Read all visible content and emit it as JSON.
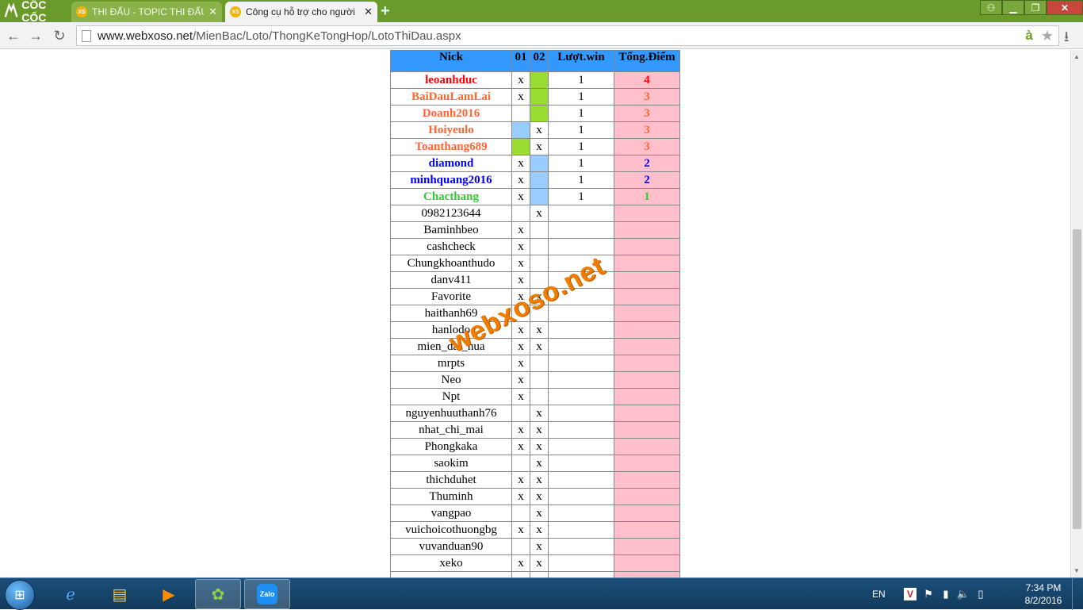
{
  "browser": {
    "brand_label": "CỐC CỐC",
    "tabs": [
      {
        "label": "THI ĐẤU - TOPIC THI ĐẤU",
        "favicon": "XS"
      },
      {
        "label": "Công cụ hỗ trợ cho người",
        "favicon": "XS"
      }
    ],
    "url_host": "www.webxoso.net",
    "url_path": "/MienBac/Loto/ThongKeTongHop/LotoThiDau.aspx"
  },
  "table": {
    "headers": {
      "nick": "Nick",
      "c01": "01",
      "c02": "02",
      "win": "Lượt.win",
      "points": "Tổng.Điểm"
    },
    "rows": [
      {
        "nick": "leoanhduc",
        "c01": "x",
        "c02": "",
        "win": "1",
        "points": "4",
        "color": "#ff0000",
        "mark02": "green"
      },
      {
        "nick": "BaiDauLamLai",
        "c01": "x",
        "c02": "",
        "win": "1",
        "points": "3",
        "color": "#ff6633",
        "mark02": "green"
      },
      {
        "nick": "Doanh2016",
        "c01": "",
        "c02": "",
        "win": "1",
        "points": "3",
        "color": "#ff6633",
        "mark02": "green"
      },
      {
        "nick": "Hoiyeulo",
        "c01": "",
        "c02": "x",
        "win": "1",
        "points": "3",
        "color": "#ff6633",
        "mark01": "blue"
      },
      {
        "nick": "Toanthang689",
        "c01": "",
        "c02": "x",
        "win": "1",
        "points": "3",
        "color": "#ff6633",
        "mark01": "green"
      },
      {
        "nick": "diamond",
        "c01": "x",
        "c02": "",
        "win": "1",
        "points": "2",
        "color": "#0000ff",
        "mark02": "blue"
      },
      {
        "nick": "minhquang2016",
        "c01": "x",
        "c02": "",
        "win": "1",
        "points": "2",
        "color": "#0000ff",
        "mark02": "blue"
      },
      {
        "nick": "Chacthang",
        "c01": "x",
        "c02": "",
        "win": "1",
        "points": "1",
        "color": "#33cc33",
        "mark02": "blue"
      },
      {
        "nick": "0982123644",
        "c01": "",
        "c02": "x",
        "win": "",
        "points": ""
      },
      {
        "nick": "Baminhbeo",
        "c01": "x",
        "c02": "",
        "win": "",
        "points": ""
      },
      {
        "nick": "cashcheck",
        "c01": "x",
        "c02": "",
        "win": "",
        "points": ""
      },
      {
        "nick": "Chungkhoanthudo",
        "c01": "x",
        "c02": "",
        "win": "",
        "points": ""
      },
      {
        "nick": "danv411",
        "c01": "x",
        "c02": "",
        "win": "",
        "points": ""
      },
      {
        "nick": "Favorite",
        "c01": "x",
        "c02": "x",
        "win": "",
        "points": ""
      },
      {
        "nick": "haithanh69",
        "c01": "",
        "c02": "",
        "win": "",
        "points": ""
      },
      {
        "nick": "hanlodo",
        "c01": "x",
        "c02": "x",
        "win": "",
        "points": ""
      },
      {
        "nick": "mien_dat_hua",
        "c01": "x",
        "c02": "x",
        "win": "",
        "points": ""
      },
      {
        "nick": "mrpts",
        "c01": "x",
        "c02": "",
        "win": "",
        "points": ""
      },
      {
        "nick": "Neo",
        "c01": "x",
        "c02": "",
        "win": "",
        "points": ""
      },
      {
        "nick": "Npt",
        "c01": "x",
        "c02": "",
        "win": "",
        "points": ""
      },
      {
        "nick": "nguyenhuuthanh76",
        "c01": "",
        "c02": "x",
        "win": "",
        "points": ""
      },
      {
        "nick": "nhat_chi_mai",
        "c01": "x",
        "c02": "x",
        "win": "",
        "points": ""
      },
      {
        "nick": "Phongkaka",
        "c01": "x",
        "c02": "x",
        "win": "",
        "points": ""
      },
      {
        "nick": "saokim",
        "c01": "",
        "c02": "x",
        "win": "",
        "points": ""
      },
      {
        "nick": "thichduhet",
        "c01": "x",
        "c02": "x",
        "win": "",
        "points": ""
      },
      {
        "nick": "Thuminh",
        "c01": "x",
        "c02": "x",
        "win": "",
        "points": ""
      },
      {
        "nick": "vangpao",
        "c01": "",
        "c02": "x",
        "win": "",
        "points": ""
      },
      {
        "nick": "vuichoicothuongbg",
        "c01": "x",
        "c02": "x",
        "win": "",
        "points": ""
      },
      {
        "nick": "vuvanduan90",
        "c01": "",
        "c02": "x",
        "win": "",
        "points": ""
      },
      {
        "nick": "xeko",
        "c01": "x",
        "c02": "x",
        "win": "",
        "points": ""
      },
      {
        "nick": "",
        "c01": "",
        "c02": "",
        "win": "",
        "points": ""
      }
    ]
  },
  "watermark": "webxoso.net",
  "taskbar": {
    "language": "EN",
    "time": "7:34 PM",
    "date": "8/2/2016",
    "zalo_label": "Zalo"
  },
  "colors": {
    "header_bg": "#3399ff",
    "points_bg": "#ffc0cb",
    "win_green": "#99dd33",
    "win_blue": "#99ccff"
  }
}
